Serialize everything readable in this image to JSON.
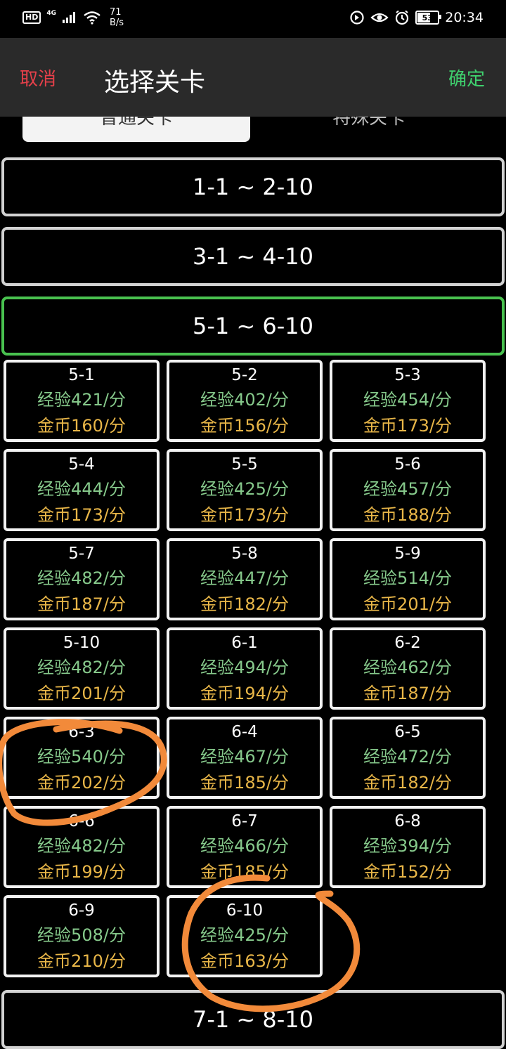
{
  "status_bar": {
    "network": "HD",
    "signal_type": "4G",
    "speed_value": "71",
    "speed_unit": "B/s",
    "battery": "53",
    "time": "20:34"
  },
  "header": {
    "cancel": "取消",
    "title": "选择关卡",
    "confirm": "确定"
  },
  "tabs": [
    {
      "label": "普通关卡",
      "selected": true
    },
    {
      "label": "特殊关卡",
      "selected": false
    }
  ],
  "groups": [
    {
      "label": "1-1 ~ 2-10",
      "active": false
    },
    {
      "label": "3-1 ~ 4-10",
      "active": false
    },
    {
      "label": "5-1 ~ 6-10",
      "active": true
    },
    {
      "label": "7-1 ~ 8-10",
      "active": false
    }
  ],
  "levels": [
    {
      "level": "5-1",
      "exp": "经验421/分",
      "gold": "金币160/分"
    },
    {
      "level": "5-2",
      "exp": "经验402/分",
      "gold": "金币156/分"
    },
    {
      "level": "5-3",
      "exp": "经验454/分",
      "gold": "金币173/分"
    },
    {
      "level": "5-4",
      "exp": "经验444/分",
      "gold": "金币173/分"
    },
    {
      "level": "5-5",
      "exp": "经验425/分",
      "gold": "金币173/分"
    },
    {
      "level": "5-6",
      "exp": "经验457/分",
      "gold": "金币188/分"
    },
    {
      "level": "5-7",
      "exp": "经验482/分",
      "gold": "金币187/分"
    },
    {
      "level": "5-8",
      "exp": "经验447/分",
      "gold": "金币182/分"
    },
    {
      "level": "5-9",
      "exp": "经验514/分",
      "gold": "金币201/分"
    },
    {
      "level": "5-10",
      "exp": "经验482/分",
      "gold": "金币201/分"
    },
    {
      "level": "6-1",
      "exp": "经验494/分",
      "gold": "金币194/分"
    },
    {
      "level": "6-2",
      "exp": "经验462/分",
      "gold": "金币187/分"
    },
    {
      "level": "6-3",
      "exp": "经验540/分",
      "gold": "金币202/分"
    },
    {
      "level": "6-4",
      "exp": "经验467/分",
      "gold": "金币185/分"
    },
    {
      "level": "6-5",
      "exp": "经验472/分",
      "gold": "金币182/分"
    },
    {
      "level": "6-6",
      "exp": "经验482/分",
      "gold": "金币199/分"
    },
    {
      "level": "6-7",
      "exp": "经验466/分",
      "gold": "金币185/分"
    },
    {
      "level": "6-8",
      "exp": "经验394/分",
      "gold": "金币152/分"
    },
    {
      "level": "6-9",
      "exp": "经验508/分",
      "gold": "金币210/分"
    },
    {
      "level": "6-10",
      "exp": "经验425/分",
      "gold": "金币163/分"
    }
  ],
  "colors": {
    "cancel": "#e5404a",
    "confirm": "#3fd16e",
    "active_group_border": "#49c24f",
    "exp_text": "#86c98b",
    "gold_text": "#e8b648",
    "annotation": "#f28a3a"
  }
}
